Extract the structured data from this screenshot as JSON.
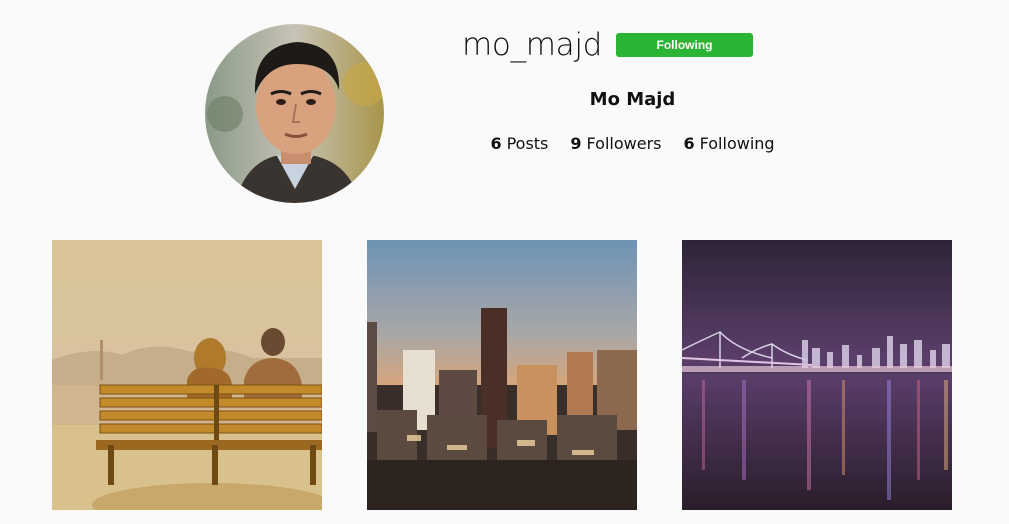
{
  "profile": {
    "username": "mo_majd",
    "follow_button_label": "Following",
    "full_name": "Mo Majd",
    "avatar_icon": "profile-photo",
    "stats": [
      {
        "count": "6",
        "label": "Posts"
      },
      {
        "count": "9",
        "label": "Followers"
      },
      {
        "count": "6",
        "label": "Following"
      }
    ]
  },
  "colors": {
    "background": "#fafafa",
    "follow_button": "#2bb534"
  },
  "posts": [
    {
      "image": "couple-on-bench-bay-view"
    },
    {
      "image": "city-skyline-sunset"
    },
    {
      "image": "bay-bridge-night-skyline"
    }
  ]
}
